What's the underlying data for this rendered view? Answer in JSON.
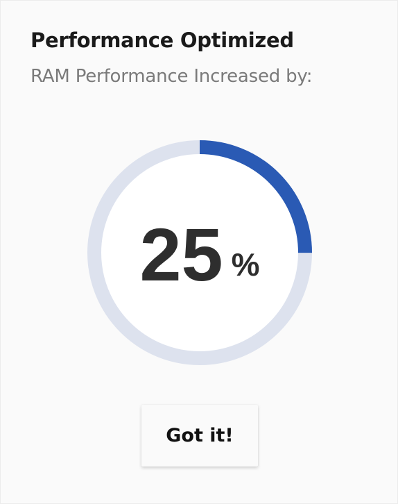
{
  "dialog": {
    "title": "Performance Optimized",
    "subtitle": "RAM Performance Increased by:"
  },
  "gauge": {
    "value": "25",
    "unit": "%",
    "percent": 25,
    "track_color": "#dde2ee",
    "progress_color": "#2a5ab4",
    "center_color": "#ffffff"
  },
  "actions": {
    "confirm_label": "Got it!"
  }
}
